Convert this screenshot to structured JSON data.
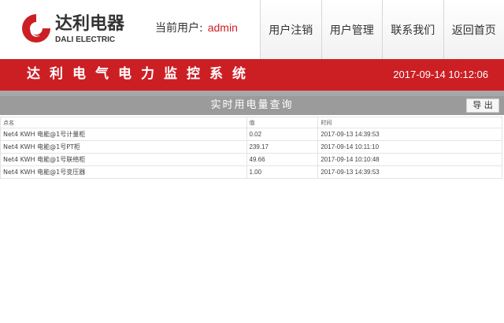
{
  "header": {
    "logo_cn": "达利电器",
    "logo_en": "DALI ELECTRIC",
    "user_label": "当前用户:",
    "user_name": "admin",
    "nav": [
      {
        "label": "用户注销"
      },
      {
        "label": "用户管理"
      },
      {
        "label": "联系我们"
      },
      {
        "label": "返回首页"
      }
    ]
  },
  "banner": {
    "title": "达利电气电力监控系统",
    "datetime": "2017-09-14 10:12:06"
  },
  "panel": {
    "title": "实时用电量查询",
    "export_label": "导 出"
  },
  "table": {
    "columns": [
      "点名",
      "值",
      "时间"
    ],
    "rows": [
      [
        "Net4 KWH 电能@1号计量柜",
        "0.02",
        "2017-09-13 14:39:53"
      ],
      [
        "Net4 KWH 电能@1号PT柜",
        "239.17",
        "2017-09-14 10:11:10"
      ],
      [
        "Net4 KWH 电能@1号联络柜",
        "49.66",
        "2017-09-14 10:10:48"
      ],
      [
        "Net4 KWH 电能@1号变压器",
        "1.00",
        "2017-09-13 14:39:53"
      ]
    ]
  },
  "colors": {
    "brand_red": "#cc1f24",
    "panel_gray": "#9b9b9b"
  },
  "icons": {
    "logo": "dali-logo-icon"
  }
}
